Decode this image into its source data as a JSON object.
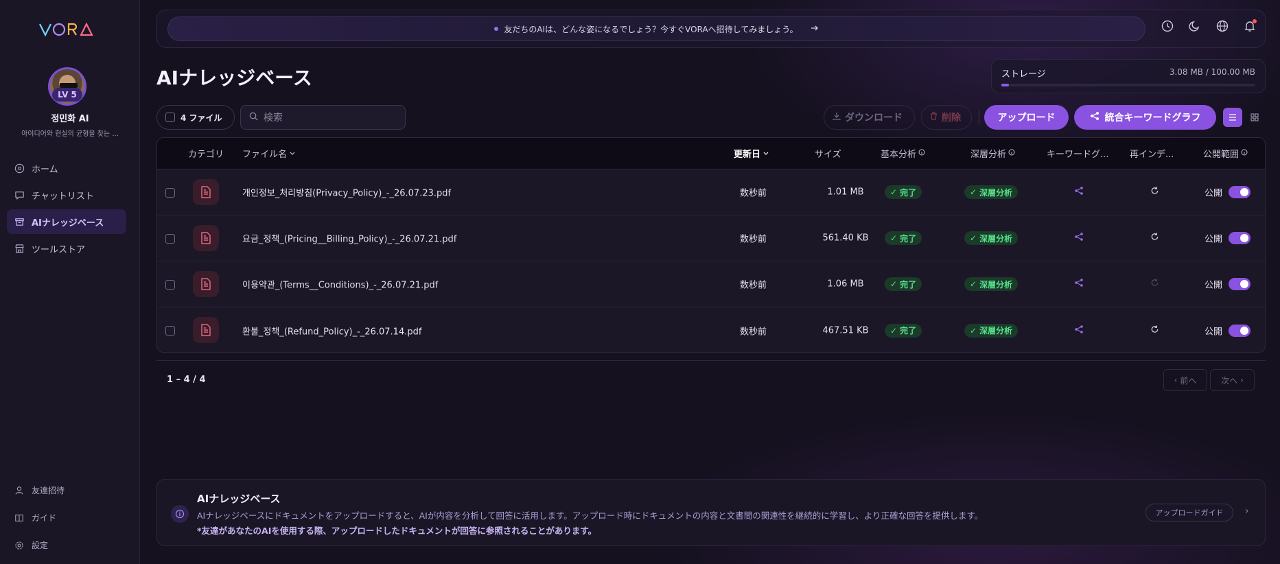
{
  "brand": {
    "logo": "VORA"
  },
  "profile": {
    "level": "LV 5",
    "name": "정민화 AI",
    "description": "아이디어와 현실의 균형을 찾는 ..."
  },
  "sidebar": {
    "items": [
      {
        "label": "ホーム",
        "icon": "home-icon",
        "active": false
      },
      {
        "label": "チャットリスト",
        "icon": "chat-icon",
        "active": false
      },
      {
        "label": "AIナレッジベース",
        "icon": "archive-icon",
        "active": true
      },
      {
        "label": "ツールストア",
        "icon": "store-icon",
        "active": false
      }
    ],
    "bottom_items": [
      {
        "label": "友達招待",
        "icon": "user-icon"
      },
      {
        "label": "ガイド",
        "icon": "book-icon"
      },
      {
        "label": "設定",
        "icon": "gear-icon"
      }
    ]
  },
  "banner": {
    "text": "友だちのAIは、どんな姿になるでしょう？今すぐVORAへ招待してみましょう。"
  },
  "page": {
    "title": "AIナレッジベース"
  },
  "storage": {
    "label": "ストレージ",
    "value": "3.08 MB / 100.00 MB",
    "fill_percent": 3.08
  },
  "toolbar": {
    "file_count": "4 ファイル",
    "search_placeholder": "検索",
    "download": "ダウンロード",
    "delete": "削除",
    "upload": "アップロード",
    "graph": "統合キーワードグラフ"
  },
  "table": {
    "headers": {
      "category": "カテゴリ",
      "filename": "ファイル名",
      "updated": "更新日",
      "size": "サイズ",
      "basic": "基本分析",
      "deep": "深層分析",
      "keyword": "キーワードグ...",
      "reindex": "再インデ...",
      "public": "公開範囲"
    },
    "rows": [
      {
        "name": "개인정보_처리방침(Privacy_Policy)_-_26.07.23.pdf",
        "updated": "数秒前",
        "size": "1.01 MB",
        "basic": "完了",
        "deep": "深層分析",
        "public": "公開",
        "reindex_enabled": true
      },
      {
        "name": "요금_정책_(Pricing__Billing_Policy)_-_26.07.21.pdf",
        "updated": "数秒前",
        "size": "561.40 KB",
        "basic": "完了",
        "deep": "深層分析",
        "public": "公開",
        "reindex_enabled": true
      },
      {
        "name": "이용약관_(Terms__Conditions)_-_26.07.21.pdf",
        "updated": "数秒前",
        "size": "1.06 MB",
        "basic": "完了",
        "deep": "深層分析",
        "public": "公開",
        "reindex_enabled": false
      },
      {
        "name": "환불_정책_(Refund_Policy)_-_26.07.14.pdf",
        "updated": "数秒前",
        "size": "467.51 KB",
        "basic": "完了",
        "deep": "深層分析",
        "public": "公開",
        "reindex_enabled": true
      }
    ]
  },
  "pagination": {
    "range": "1 – 4 / 4",
    "prev": "前へ",
    "next": "次へ"
  },
  "info": {
    "title": "AIナレッジベース",
    "text": "AIナレッジベースにドキュメントをアップロードすると、AIが内容を分析して回答に活用します。アップロード時にドキュメントの内容と文書間の関連性を継続的に学習し、より正確な回答を提供します。",
    "note": "*友達があなたのAIを使用する際、アップロードしたドキュメントが回答に参照されることがあります。",
    "guide_button": "アップロードガイド"
  },
  "colors": {
    "accent": "#8a52e0",
    "success": "#56e08a",
    "background": "#15111f"
  }
}
